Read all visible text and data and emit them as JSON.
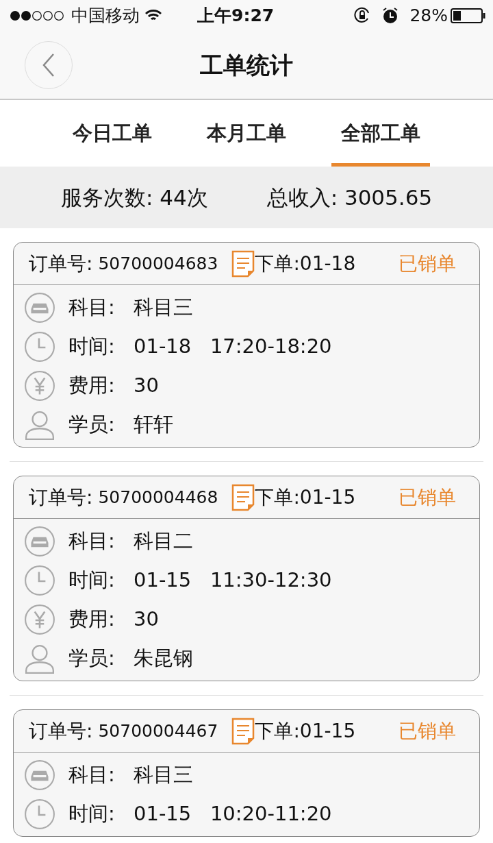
{
  "status_bar": {
    "carrier": "中国移动",
    "time": "上午9:27",
    "battery": "28%"
  },
  "nav_bar": {
    "title": "工单统计"
  },
  "tabs": [
    {
      "label": "今日工单",
      "selected": false
    },
    {
      "label": "本月工单",
      "selected": false
    },
    {
      "label": "全部工单",
      "selected": true
    }
  ],
  "summary": {
    "services": "服务次数: 44次",
    "income": "总收入: 3005.65"
  },
  "orders": [
    {
      "order_label": "订单号:",
      "order_no": "50700004683",
      "placed": "下单:01-18",
      "status": "已销单",
      "rows": [
        {
          "kind": "subject",
          "label": "科目:",
          "value": "科目三"
        },
        {
          "kind": "time",
          "label": "时间:",
          "value": "01-18   17:20-18:20"
        },
        {
          "kind": "fee",
          "label": "费用:",
          "value": "30"
        },
        {
          "kind": "student",
          "label": "学员:",
          "value": "轩轩"
        }
      ]
    },
    {
      "order_label": "订单号:",
      "order_no": "50700004468",
      "placed": "下单:01-15",
      "status": "已销单",
      "rows": [
        {
          "kind": "subject",
          "label": "科目:",
          "value": "科目二"
        },
        {
          "kind": "time",
          "label": "时间:",
          "value": "01-15   11:30-12:30"
        },
        {
          "kind": "fee",
          "label": "费用:",
          "value": "30"
        },
        {
          "kind": "student",
          "label": "学员:",
          "value": "朱昆钢"
        }
      ]
    },
    {
      "order_label": "订单号:",
      "order_no": "50700004467",
      "placed": "下单:01-15",
      "status": "已销单",
      "rows": [
        {
          "kind": "subject",
          "label": "科目:",
          "value": "科目三"
        },
        {
          "kind": "time",
          "label": "时间:",
          "value": "01-15   10:20-11:20"
        }
      ]
    }
  ]
}
